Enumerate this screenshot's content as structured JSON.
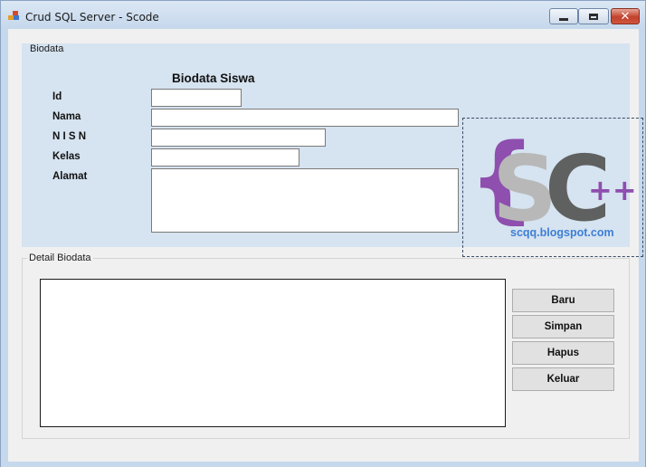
{
  "window": {
    "title": "Crud SQL Server - Scode",
    "controls": {
      "minimize_icon": "minimize-icon",
      "maximize_icon": "maximize-icon",
      "close_glyph": "✕"
    }
  },
  "biodata_group": {
    "legend": "Biodata",
    "title": "Biodata Siswa",
    "fields": {
      "id": {
        "label": "Id",
        "value": ""
      },
      "nama": {
        "label": "Nama",
        "value": ""
      },
      "nisn": {
        "label": "N I S N",
        "value": ""
      },
      "kelas": {
        "label": "Kelas",
        "value": ""
      },
      "alamat": {
        "label": "Alamat",
        "value": ""
      }
    },
    "logo": {
      "brace": "{",
      "letters": "SC",
      "plus": "++",
      "url": "scqq.blogspot.com",
      "colors": {
        "brace": "#8e4fae",
        "s": "#b8b8b8",
        "c": "#5f6060",
        "plus": "#8e4fae",
        "url": "#3d7fd6"
      }
    }
  },
  "detail_group": {
    "legend": "Detail Biodata",
    "buttons": {
      "baru": "Baru",
      "simpan": "Simpan",
      "hapus": "Hapus",
      "keluar": "Keluar"
    }
  }
}
